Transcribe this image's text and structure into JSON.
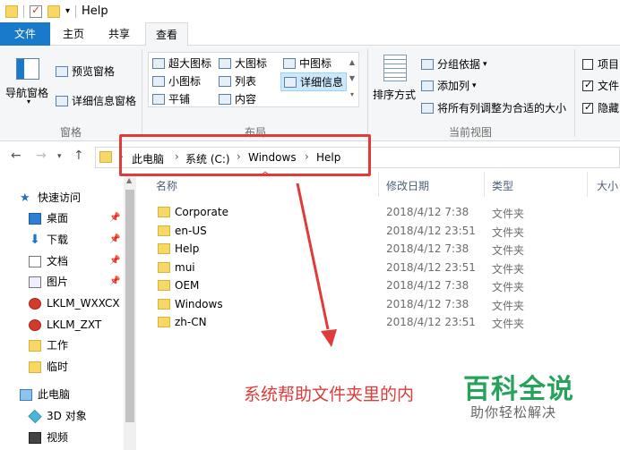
{
  "window": {
    "title": "Help"
  },
  "tabs": [
    {
      "label": "文件"
    },
    {
      "label": "主页"
    },
    {
      "label": "共享"
    },
    {
      "label": "查看"
    }
  ],
  "ribbon": {
    "panes": {
      "nav_pane": "导航窗格",
      "preview_pane": "预览窗格",
      "details_pane": "详细信息窗格",
      "label": "窗格"
    },
    "layout": {
      "extra_large": "超大图标",
      "large": "大图标",
      "medium": "中图标",
      "small": "小图标",
      "list": "列表",
      "details": "详细信息",
      "tiles": "平铺",
      "content": "内容",
      "label": "布局"
    },
    "current_view": {
      "sort_by": "排序方式",
      "group_by": "分组依据",
      "add_column": "添加列",
      "size_all_columns": "将所有列调整为合适的大小",
      "label": "当前视图"
    },
    "show_hide": {
      "item_checkboxes": "项目",
      "file_extensions": "文件",
      "hidden_items": "隐藏"
    }
  },
  "address": {
    "crumbs": [
      "此电脑",
      "系统 (C:)",
      "Windows",
      "Help"
    ]
  },
  "sidebar": {
    "quick_access": "快速访问",
    "items": [
      {
        "label": "桌面",
        "icon": "desktop-icon",
        "pinned": true
      },
      {
        "label": "下载",
        "icon": "download-icon",
        "pinned": true
      },
      {
        "label": "文档",
        "icon": "document-icon",
        "pinned": true
      },
      {
        "label": "图片",
        "icon": "picture-icon",
        "pinned": true
      },
      {
        "label": "LKLM_WXXCX",
        "icon": "drive-icon",
        "pinned": false
      },
      {
        "label": "LKLM_ZXT",
        "icon": "drive-icon",
        "pinned": false
      },
      {
        "label": "工作",
        "icon": "folder-icon",
        "pinned": false
      },
      {
        "label": "临时",
        "icon": "folder-icon",
        "pinned": false
      }
    ],
    "this_pc": "此电脑",
    "pc_items": [
      {
        "label": "3D 对象",
        "icon": "3d-objects-icon"
      },
      {
        "label": "视频",
        "icon": "video-icon"
      }
    ]
  },
  "file_list": {
    "columns": {
      "name": "名称",
      "modified": "修改日期",
      "type": "类型",
      "size": "大小"
    },
    "rows": [
      {
        "name": "Corporate",
        "modified": "2018/4/12 7:38",
        "type": "文件夹"
      },
      {
        "name": "en-US",
        "modified": "2018/4/12 23:51",
        "type": "文件夹"
      },
      {
        "name": "Help",
        "modified": "2018/4/12 7:38",
        "type": "文件夹"
      },
      {
        "name": "mui",
        "modified": "2018/4/12 23:51",
        "type": "文件夹"
      },
      {
        "name": "OEM",
        "modified": "2018/4/12 7:38",
        "type": "文件夹"
      },
      {
        "name": "Windows",
        "modified": "2018/4/12 7:38",
        "type": "文件夹"
      },
      {
        "name": "zh-CN",
        "modified": "2018/4/12 23:51",
        "type": "文件夹"
      }
    ]
  },
  "annotation": {
    "text": "系统帮助文件夹里的内",
    "color": "#e03a3a"
  },
  "watermark": {
    "title": "百科全说",
    "subtitle": "助你轻松解决",
    "color": "#25a35a"
  },
  "colors": {
    "accent": "#1979ca",
    "selection": "#cce8ff"
  }
}
